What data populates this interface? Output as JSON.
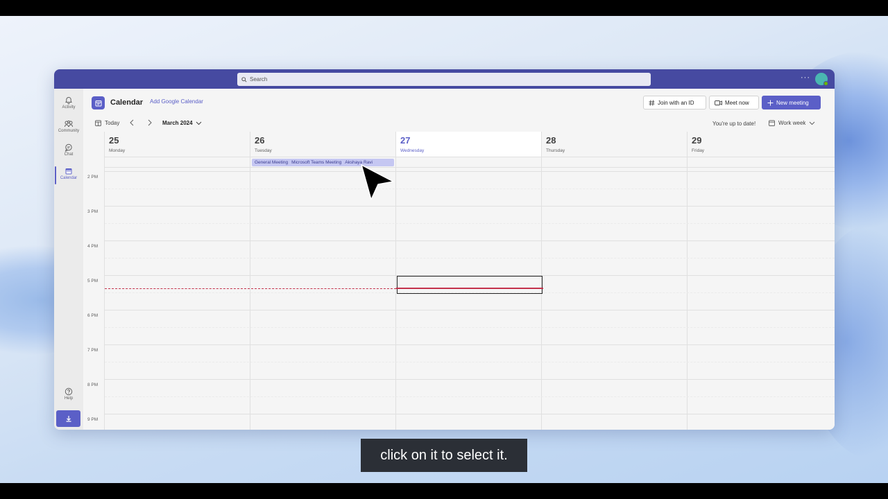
{
  "topbar": {
    "search_placeholder": "Search",
    "more_label": "···"
  },
  "rail": {
    "items": [
      {
        "label": "Activity",
        "icon": "bell-icon"
      },
      {
        "label": "Community",
        "icon": "community-icon"
      },
      {
        "label": "Chat",
        "icon": "chat-icon"
      },
      {
        "label": "Calendar",
        "icon": "calendar-icon",
        "active": true
      }
    ],
    "help_label": "Help",
    "download_icon": "download-icon"
  },
  "header": {
    "title": "Calendar",
    "add_google": "Add Google Calendar",
    "join_label": "Join with an ID",
    "meet_label": "Meet now",
    "new_meeting_label": "New meeting"
  },
  "toolbar": {
    "today_label": "Today",
    "month_label": "March 2024",
    "status": "You're up to date!",
    "view_label": "Work week"
  },
  "days": [
    {
      "num": "25",
      "name": "Monday"
    },
    {
      "num": "26",
      "name": "Tuesday"
    },
    {
      "num": "27",
      "name": "Wednesday",
      "today": true
    },
    {
      "num": "28",
      "name": "Thursday"
    },
    {
      "num": "29",
      "name": "Friday"
    }
  ],
  "times": [
    "2 PM",
    "3 PM",
    "4 PM",
    "5 PM",
    "6 PM",
    "7 PM",
    "8 PM",
    "9 PM"
  ],
  "allday_event": {
    "title": "General Meeting",
    "location": "Microsoft Teams Meeting",
    "organizer": "Akshaya Ravi"
  },
  "caption": "click on it to select it.",
  "colors": {
    "brand": "#5b5fc7",
    "titlebar": "#464aa1",
    "now_line": "#c4314b"
  }
}
